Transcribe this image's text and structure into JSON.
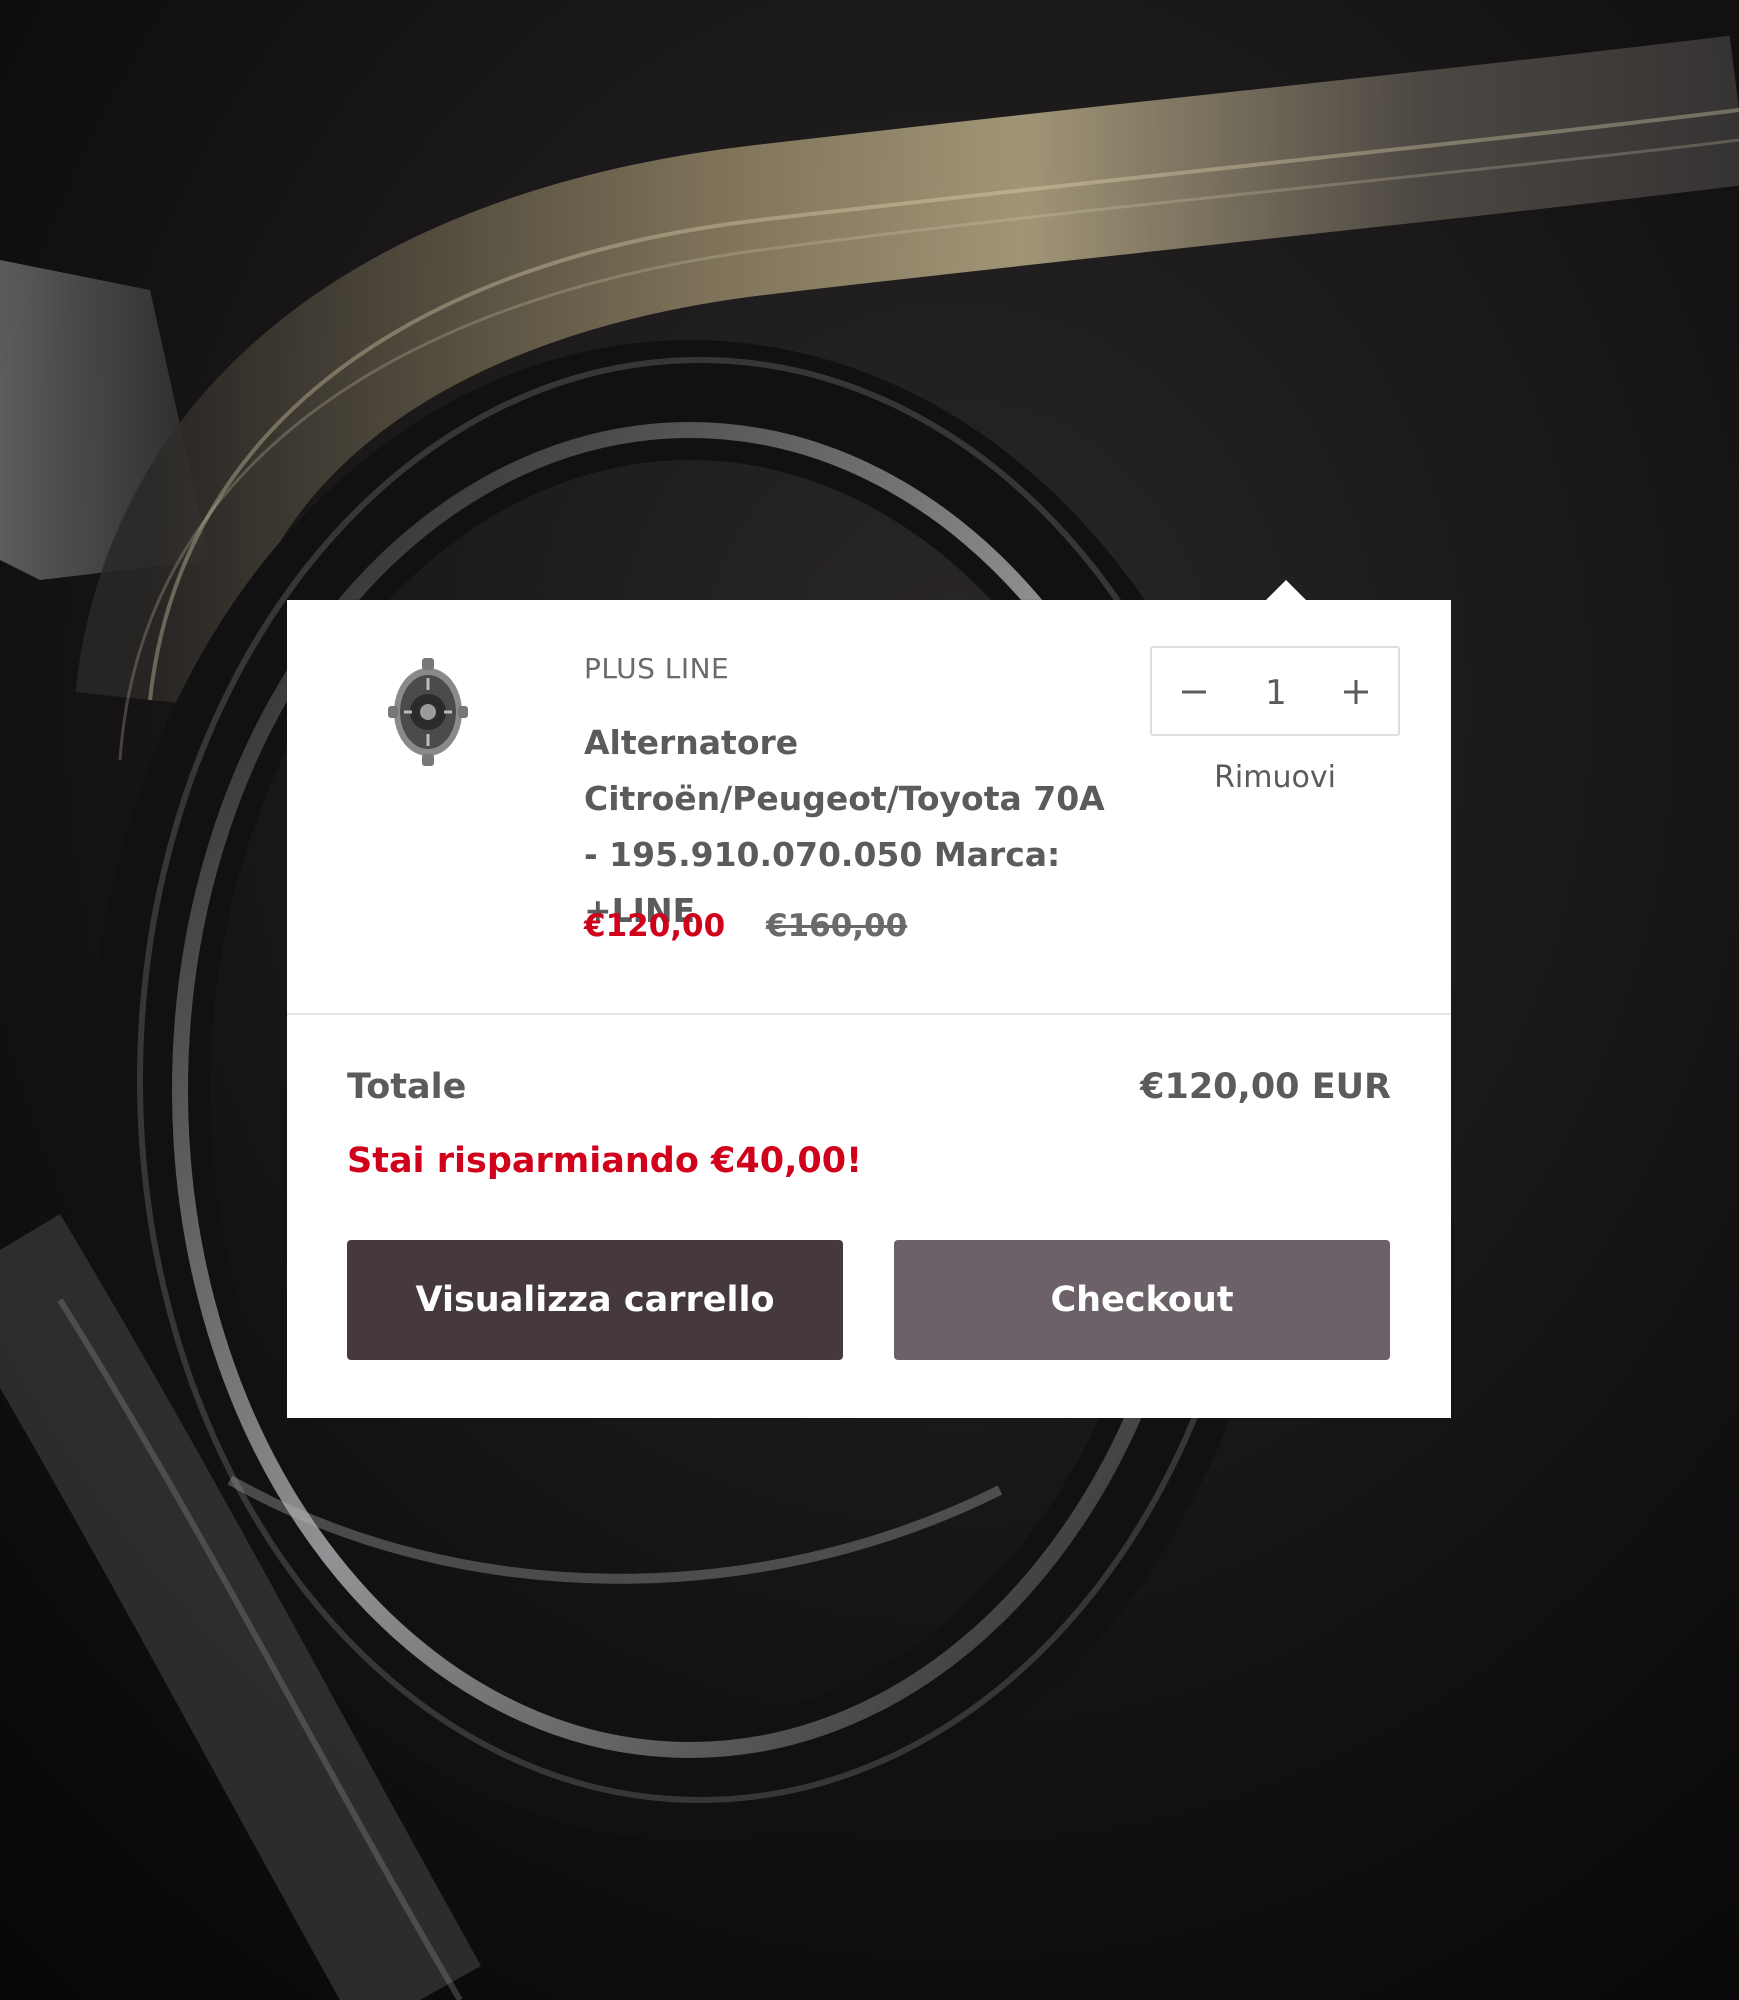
{
  "colors": {
    "sale": "#d0021b",
    "text": "#5b5a5c",
    "button_primary": "#45393f",
    "button_secondary": "#6c6168"
  },
  "cart": {
    "item": {
      "image_icon": "alternator-icon",
      "vendor": "PLUS LINE",
      "title": "Alternatore Citroën/Peugeot/Toyota 70A - 195.910.070.050 Marca: +LINE",
      "sale_price": "€120,00",
      "compare_price": "€160,00",
      "quantity": "1",
      "remove_label": "Rimuovi",
      "qty_minus_icon": "minus-icon",
      "qty_plus_icon": "plus-icon"
    },
    "total_label": "Totale",
    "total_value": "€120,00 EUR",
    "savings_text": "Stai risparmiando €40,00!",
    "view_cart_label": "Visualizza carrello",
    "checkout_label": "Checkout"
  }
}
